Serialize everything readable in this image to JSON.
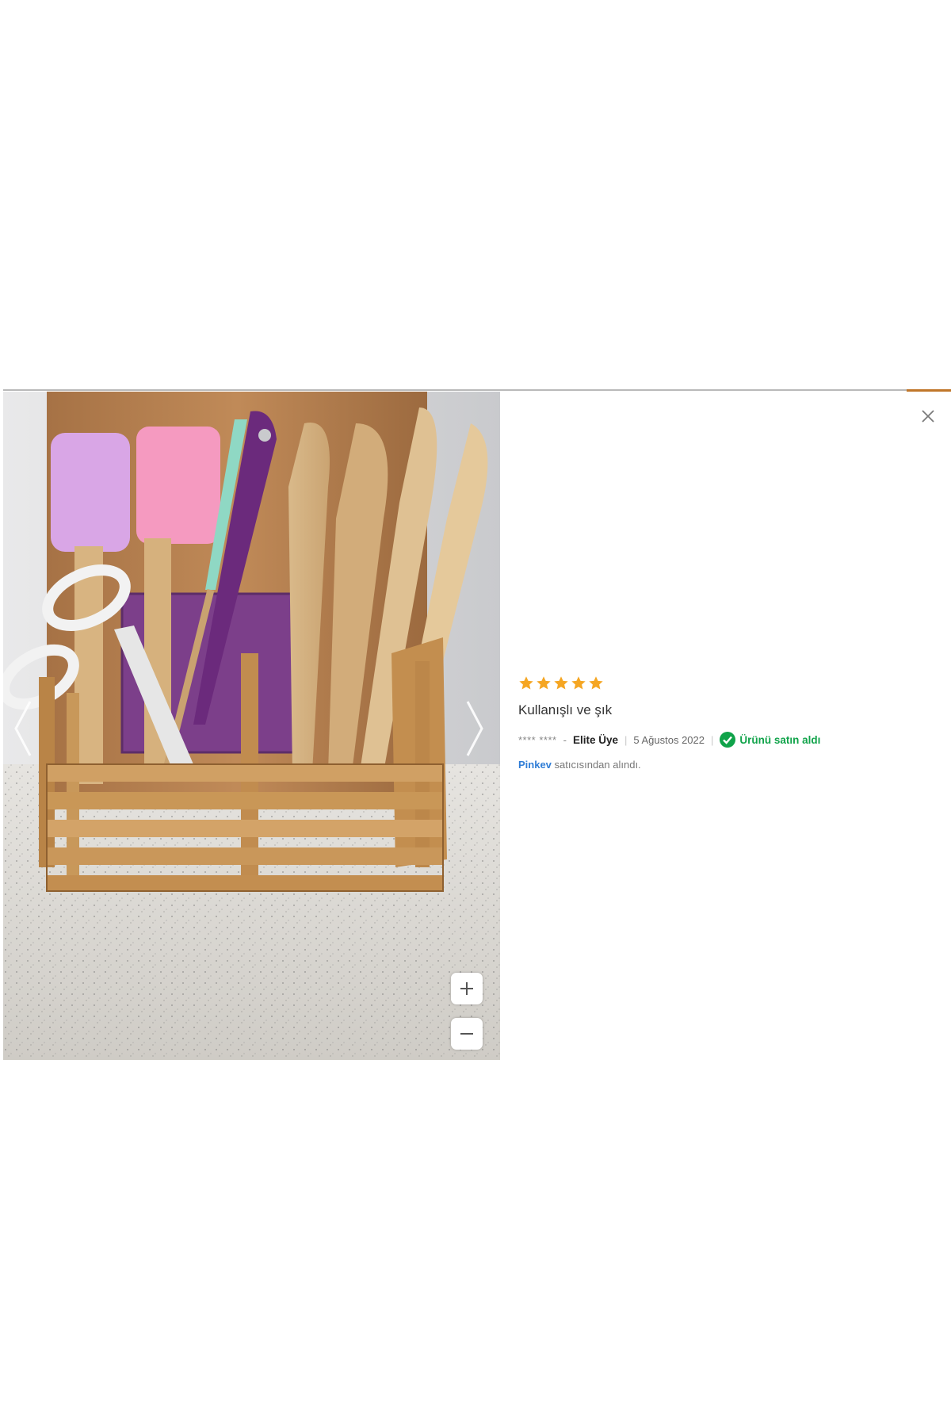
{
  "review": {
    "rating": 5,
    "rating_max": 5,
    "title": "Kullanışlı ve şık",
    "reviewer_masked": "**** ****",
    "dash": "-",
    "member_level": "Elite Üye",
    "date": "5 Ağustos 2022",
    "verified_label": "Ürünü satın aldı",
    "seller_name": "Pinkev",
    "seller_suffix": "satıcısından alındı."
  },
  "icons": {
    "close": "close-icon",
    "prev": "chevron-left-icon",
    "next": "chevron-right-icon",
    "zoom_in": "plus-icon",
    "zoom_out": "minus-icon",
    "star": "star-icon",
    "verified": "check-circle-icon"
  },
  "colors": {
    "star": "#f5a623",
    "verified": "#10a34a",
    "seller_link": "#2f7dd6",
    "accent": "#c0762a"
  },
  "photo": {
    "subject": "Bamboo utensil holder with spatulas, scissors and wooden spoons"
  }
}
